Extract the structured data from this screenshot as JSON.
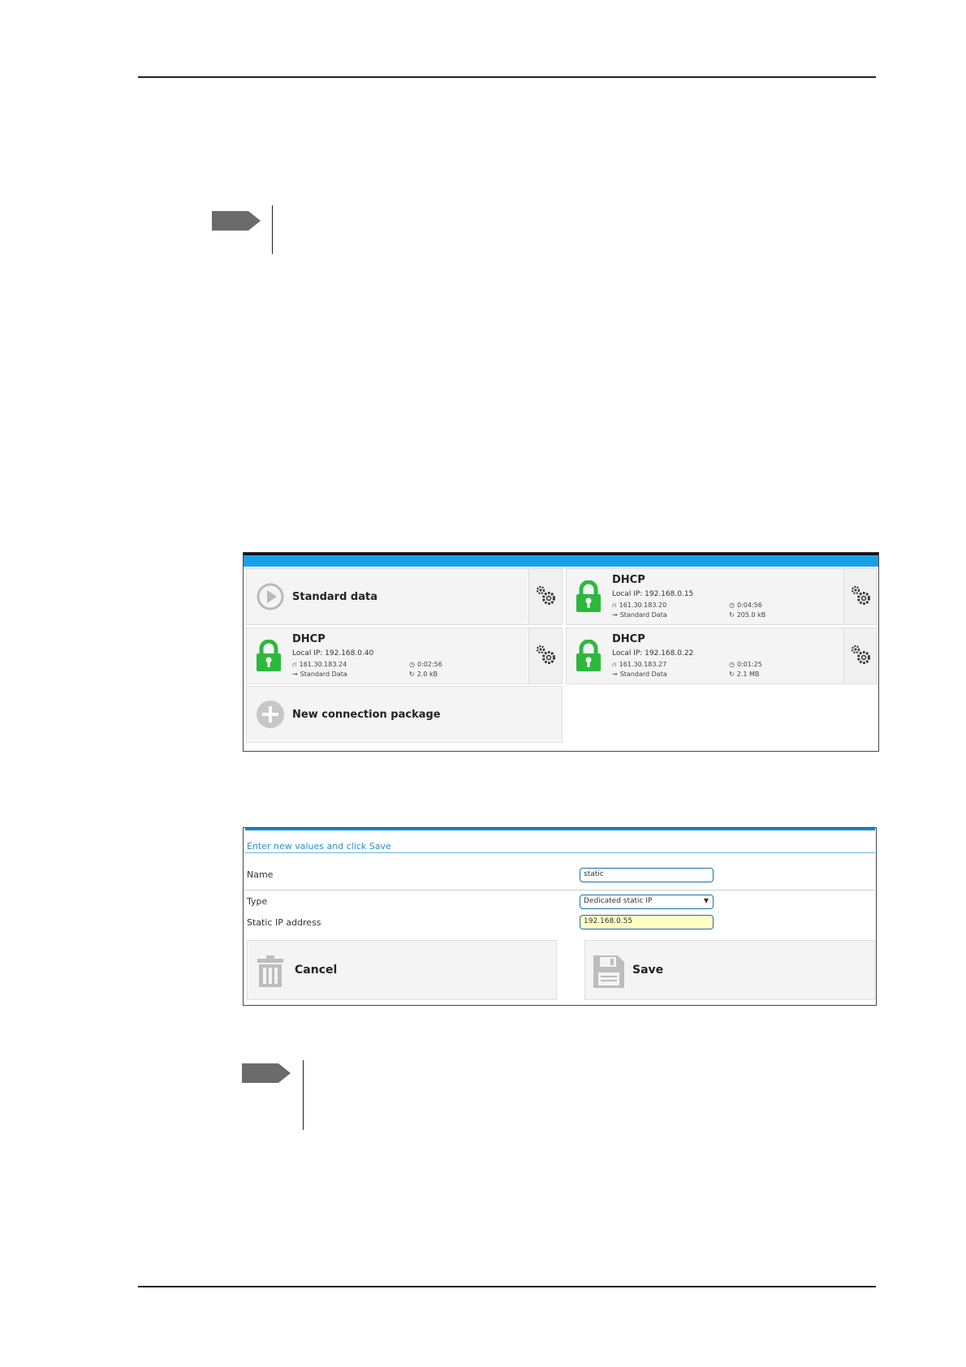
{
  "connections": {
    "standard_tile": {
      "title": "Standard data"
    },
    "tiles": [
      {
        "title": "DHCP",
        "local_ip": "Local IP: 192.168.0.15",
        "public_ip": "161.30.183.20",
        "data_type": "Standard Data",
        "duration": "0:04:56",
        "transferred": "205.0 kB"
      },
      {
        "title": "DHCP",
        "local_ip": "Local IP: 192.168.0.40",
        "public_ip": "161.30.183.24",
        "data_type": "Standard Data",
        "duration": "0:02:56",
        "transferred": "2.0 kB"
      },
      {
        "title": "DHCP",
        "local_ip": "Local IP: 192.168.0.22",
        "public_ip": "161.30.183.27",
        "data_type": "Standard Data",
        "duration": "0:01:25",
        "transferred": "2.1 MB"
      }
    ],
    "new_tile": {
      "title": "New connection package"
    },
    "colors": {
      "accent_bar": "#1aa0e8",
      "lock_green": "#2db83d"
    }
  },
  "form": {
    "heading": "Enter new values and click Save",
    "name_label": "Name",
    "name_value": "static",
    "type_label": "Type",
    "type_value": "Dedicated static IP",
    "ip_label": "Static IP address",
    "ip_value": "192.168.0.55",
    "cancel_label": "Cancel",
    "save_label": "Save"
  }
}
